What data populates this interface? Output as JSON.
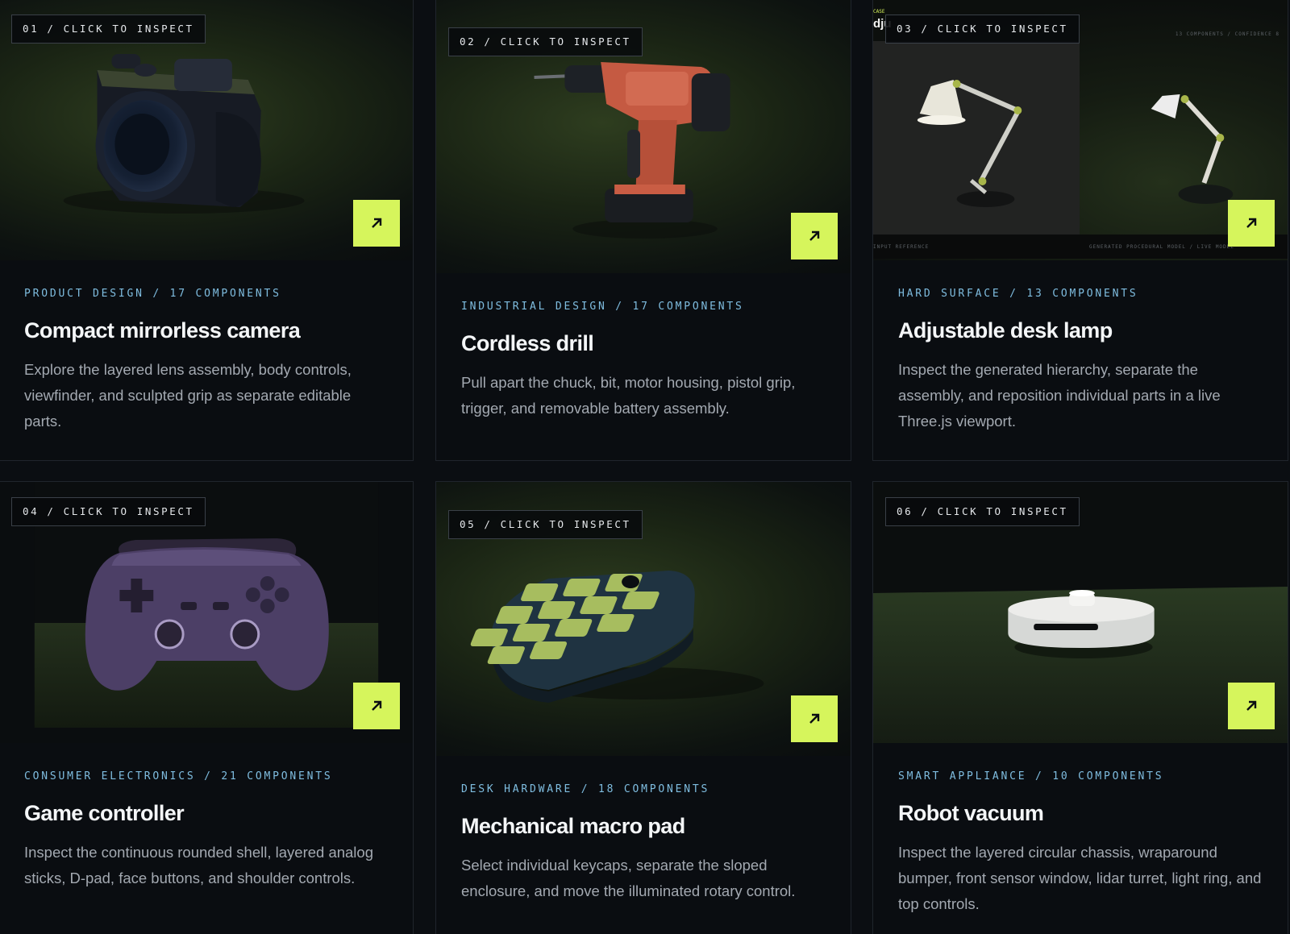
{
  "accent_color": "#d6f55c",
  "open_icon": "arrow-up-right-icon",
  "cards": [
    {
      "tag": "01 / CLICK TO INSPECT",
      "meta": "PRODUCT DESIGN / 17 COMPONENTS",
      "title": "Compact mirrorless camera",
      "description": "Explore the layered lens assembly, body controls, viewfinder, and sculpted grip as separate editable parts.",
      "preview": "camera-model"
    },
    {
      "tag": "02 / CLICK TO INSPECT",
      "meta": "INDUSTRIAL DESIGN / 17 COMPONENTS",
      "title": "Cordless drill",
      "description": "Pull apart the chuck, bit, motor housing, pistol grip, trigger, and removable battery assembly.",
      "preview": "drill-model"
    },
    {
      "tag": "03 / CLICK TO INSPECT",
      "meta": "HARD SURFACE / 13 COMPONENTS",
      "title": "Adjustable desk lamp",
      "description": "Inspect the generated hierarchy, separate the assembly, and reposition individual parts in a live Three.js viewport.",
      "preview": "desk-lamp-model",
      "preview_labels": {
        "case": "CASE",
        "name": "dju",
        "top_right": "13 COMPONENTS / CONFIDENCE 8",
        "bottom_left": "INPUT REFERENCE",
        "bottom_right": "GENERATED PROCEDURAL MODEL / LIVE MODEL"
      }
    },
    {
      "tag": "04 / CLICK TO INSPECT",
      "meta": "CONSUMER ELECTRONICS / 21 COMPONENTS",
      "title": "Game controller",
      "description": "Inspect the continuous rounded shell, layered analog sticks, D-pad, face buttons, and shoulder controls.",
      "preview": "game-controller-model"
    },
    {
      "tag": "05 / CLICK TO INSPECT",
      "meta": "DESK HARDWARE / 18 COMPONENTS",
      "title": "Mechanical macro pad",
      "description": "Select individual keycaps, separate the sloped enclosure, and move the illuminated rotary control.",
      "preview": "macro-pad-model"
    },
    {
      "tag": "06 / CLICK TO INSPECT",
      "meta": "SMART APPLIANCE / 10 COMPONENTS",
      "title": "Robot vacuum",
      "description": "Inspect the layered circular chassis, wraparound bumper, front sensor window, lidar turret, light ring, and top controls.",
      "preview": "robot-vacuum-model"
    }
  ]
}
